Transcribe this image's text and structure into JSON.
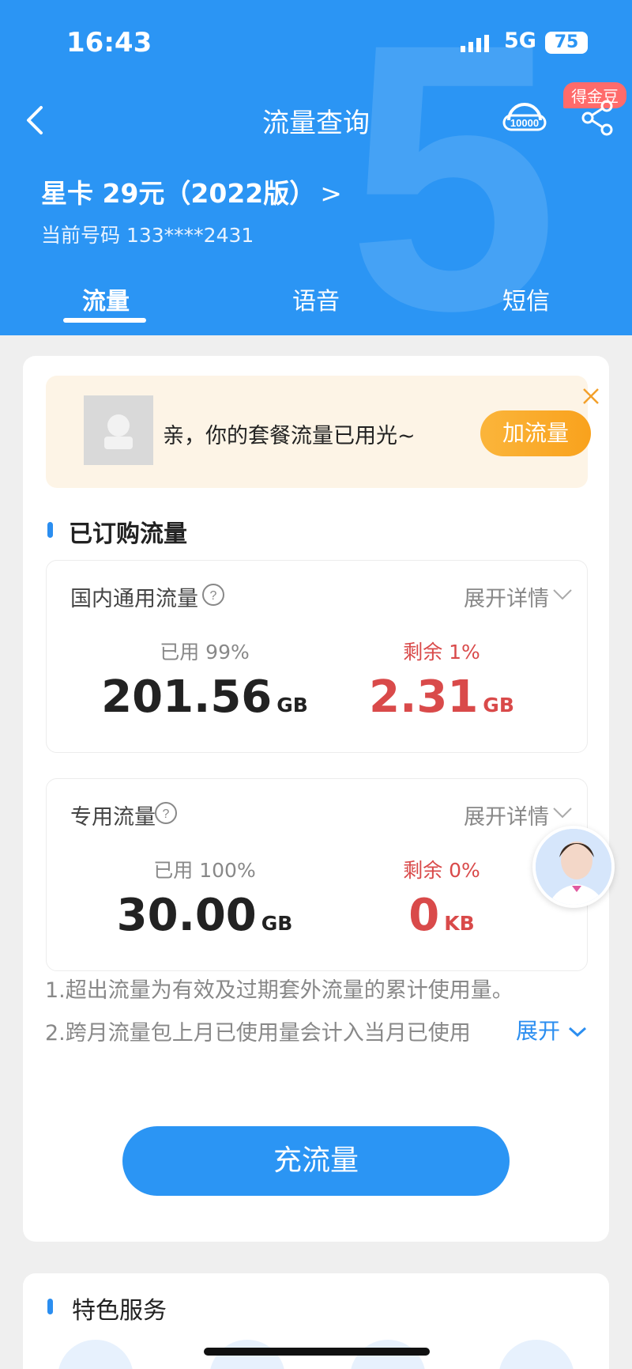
{
  "status_bar": {
    "time": "16:43",
    "network": "5G",
    "battery": "75"
  },
  "nav": {
    "title": "流量查询",
    "coin_badge": "得金豆",
    "back_icon": "chevron-left-icon",
    "service_icon": "10000-headset-icon",
    "share_icon": "share-icon"
  },
  "plan": {
    "name": "星卡 29元（2022版）",
    "arrow": ">",
    "phone_label": "当前号码 133****2431"
  },
  "tabs": [
    {
      "label": "流量",
      "active": true
    },
    {
      "label": "语音"
    },
    {
      "label": "短信"
    }
  ],
  "notice": {
    "message": "亲，你的套餐流量已用光~",
    "button": "加流量"
  },
  "section": {
    "title": "已订购流量"
  },
  "boxes": [
    {
      "title": "国内通用流量",
      "expand": "展开详情",
      "used_label": "已用 99%",
      "used_value": "201.56",
      "used_unit": "GB",
      "left_label": "剩余 1%",
      "left_value": "2.31",
      "left_unit": "GB"
    },
    {
      "title": "专用流量",
      "expand": "展开详情",
      "used_label": "已用 100%",
      "used_value": "30.00",
      "used_unit": "GB",
      "left_label": "剩余 0%",
      "left_value": "0",
      "left_unit": "KB"
    }
  ],
  "notes": [
    "1.超出流量为有效及过期套外流量的累计使用量。",
    "2.跨月流量包上月已使用量会计入当月已使用"
  ],
  "expand_label": "展开",
  "recharge_button": "充流量",
  "features": {
    "title": "特色服务"
  },
  "colors": {
    "primary": "#2b95f4",
    "danger": "#d94a4a",
    "accent": "#f9a21d"
  }
}
